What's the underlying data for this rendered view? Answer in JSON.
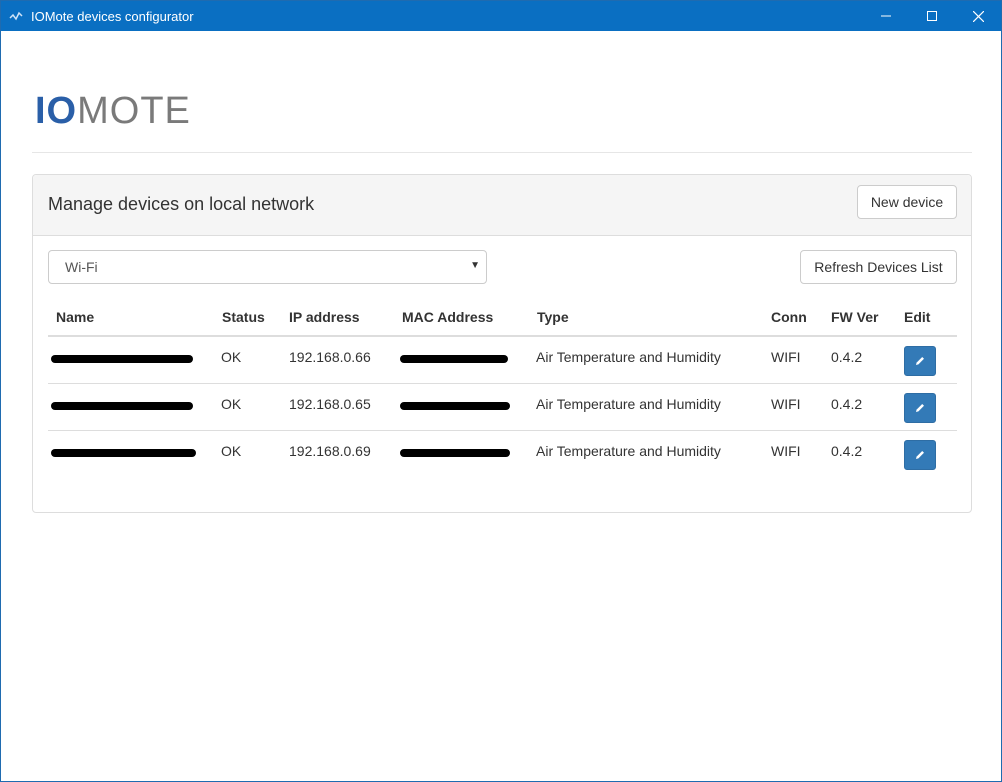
{
  "window": {
    "title": "IOMote devices configurator",
    "controls": {
      "minimize": "minimize-icon",
      "maximize": "maximize-icon",
      "close": "close-icon"
    }
  },
  "logo": {
    "part1": "IO",
    "part2": "MOTE"
  },
  "panel": {
    "title": "Manage devices on local network",
    "new_device_label": "New device",
    "refresh_label": "Refresh Devices List",
    "connection_select": {
      "selected": "Wi-Fi"
    }
  },
  "table": {
    "headers": [
      "Name",
      "Status",
      "IP address",
      "MAC Address",
      "Type",
      "Conn",
      "FW Ver",
      "Edit"
    ],
    "rows": [
      {
        "status": "OK",
        "ip": "192.168.0.66",
        "type": "Air Temperature and Humidity",
        "conn": "WIFI",
        "fw": "0.4.2"
      },
      {
        "status": "OK",
        "ip": "192.168.0.65",
        "type": "Air Temperature and Humidity",
        "conn": "WIFI",
        "fw": "0.4.2"
      },
      {
        "status": "OK",
        "ip": "192.168.0.69",
        "type": "Air Temperature and Humidity",
        "conn": "WIFI",
        "fw": "0.4.2"
      }
    ]
  },
  "colors": {
    "titlebar": "#0a6fc2",
    "accent": "#337ab7",
    "logo_io": "#2a5fa8",
    "logo_mote": "#7a7a7a"
  }
}
